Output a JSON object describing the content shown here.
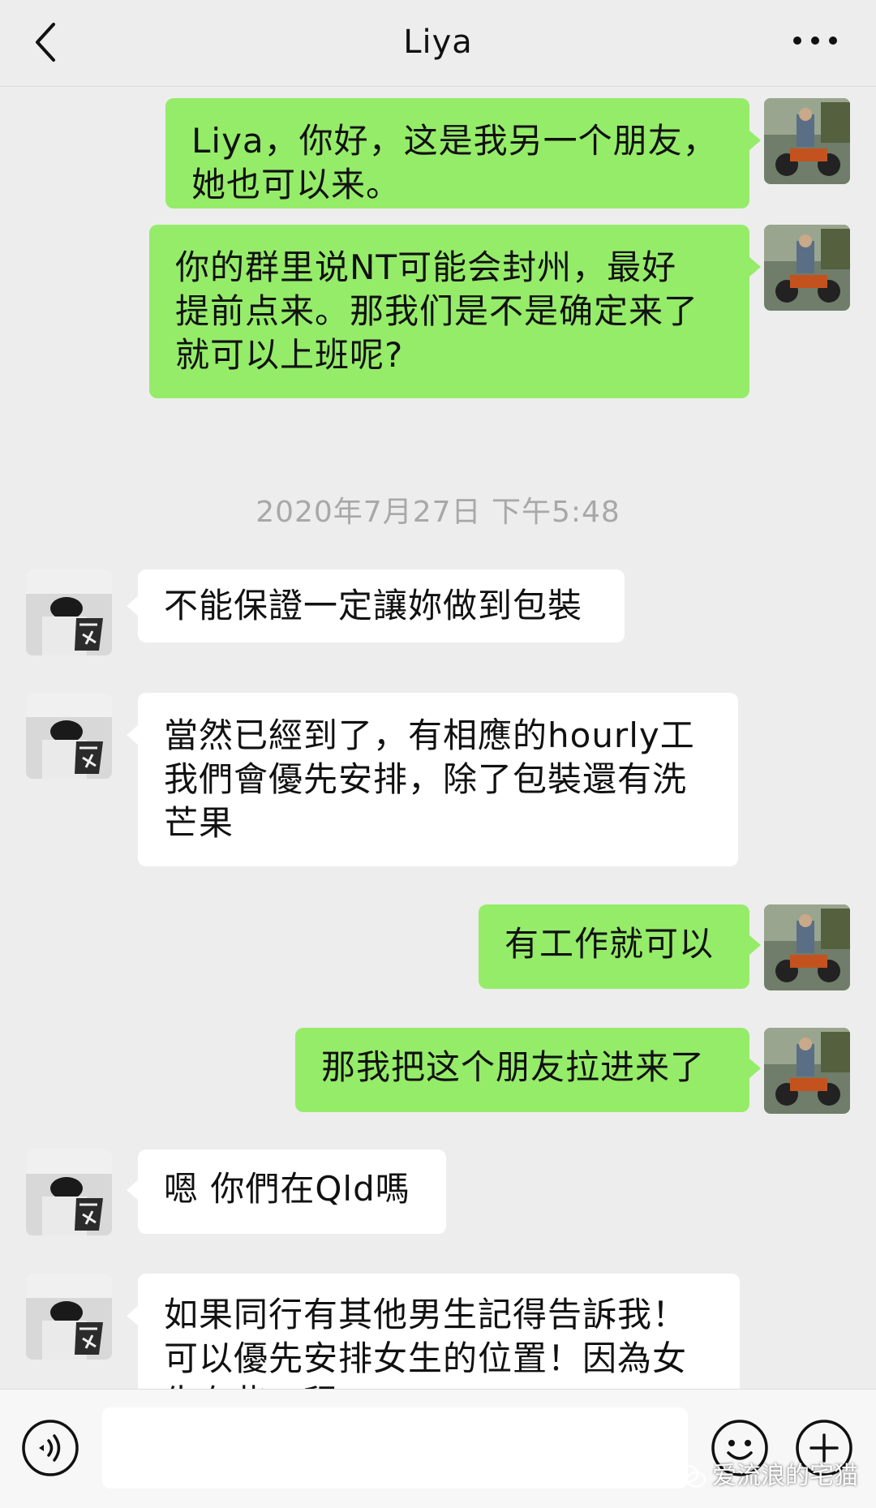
{
  "header": {
    "title": "Liya",
    "back_icon": "chevron-left-icon",
    "more_icon": "more-dots-icon"
  },
  "messages": [
    {
      "side": "right",
      "lines": [
        "Liya，你好，这是我另一个朋友，",
        "她也可以来。"
      ]
    },
    {
      "side": "right",
      "lines": [
        "你的群里说NT可能会封州，最好",
        "提前点来。那我们是不是确定来了",
        "就可以上班呢?"
      ]
    },
    {
      "timestamp": "2020年7月27日 下午5:48"
    },
    {
      "side": "left",
      "lines": [
        "不能保證一定讓妳做到包裝"
      ]
    },
    {
      "side": "left",
      "lines": [
        "當然已經到了，有相應的hourly工",
        "我們會優先安排，除了包裝還有洗",
        "芒果"
      ]
    },
    {
      "side": "right",
      "lines": [
        "有工作就可以"
      ]
    },
    {
      "side": "right",
      "lines": [
        "那我把这个朋友拉进来了"
      ]
    },
    {
      "side": "left",
      "lines": [
        "嗯 你們在Qld嗎"
      ]
    },
    {
      "side": "left",
      "lines": [
        " 如果同行有其他男生記得告訴我！",
        "可以優先安排女生的位置！因為女",
        "生有些工程"
      ]
    }
  ],
  "input_bar": {
    "voice_icon": "voice-icon",
    "input_value": "",
    "emoji_icon": "emoji-icon",
    "plus_icon": "plus-icon"
  },
  "watermark": {
    "text": "爱流浪的宅猫",
    "icon": "wechat-icon"
  },
  "colors": {
    "background": "#ededed",
    "sent_bubble": "#95ec69",
    "received_bubble": "#ffffff",
    "timestamp": "#a8a8a8"
  }
}
